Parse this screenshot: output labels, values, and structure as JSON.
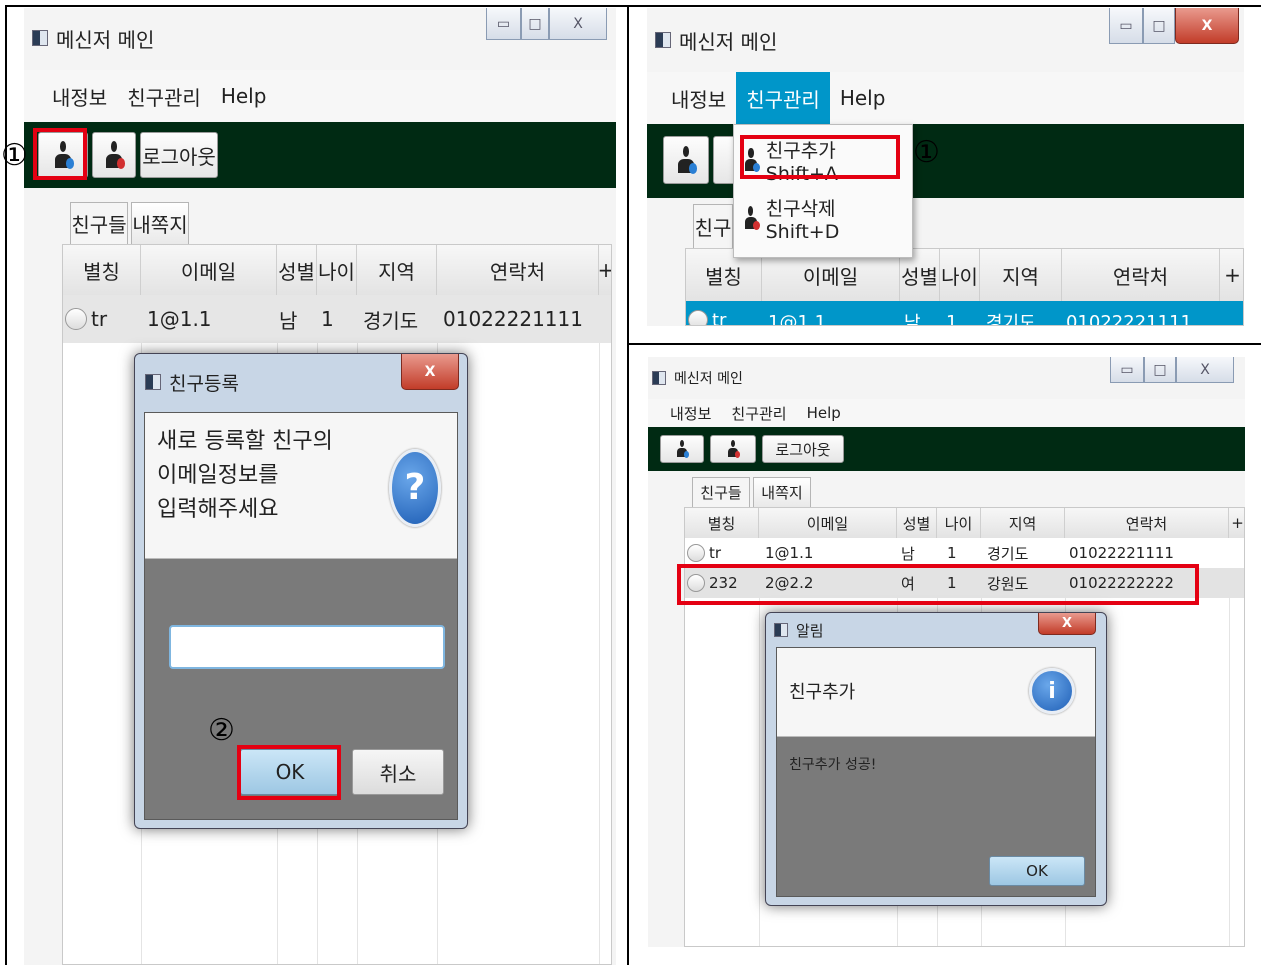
{
  "step_markers": {
    "one": "①",
    "two": "②"
  },
  "window": {
    "title": "메신저 메인",
    "min_glyph": "▭",
    "max_glyph": "□",
    "close_glyph": "X"
  },
  "menu": {
    "my_info": "내정보",
    "friends": "친구관리",
    "help": "Help"
  },
  "toolbar": {
    "logout": "로그아웃"
  },
  "tabs": {
    "friends": "친구들",
    "notes": "내쪽지"
  },
  "table": {
    "headers": [
      "별칭",
      "이메일",
      "성별",
      "나이",
      "지역",
      "연락처"
    ],
    "add_column": "+",
    "rows": [
      {
        "nick": "tr",
        "email": "1@1.1",
        "gender": "남",
        "age": "1",
        "region": "경기도",
        "phone": "01022221111"
      },
      {
        "nick": "232",
        "email": "2@2.2",
        "gender": "여",
        "age": "1",
        "region": "강원도",
        "phone": "01022222222"
      }
    ]
  },
  "dropdown": {
    "add": "친구추가 Shift+A",
    "delete": "친구삭제 Shift+D",
    "partial_tab": "친구"
  },
  "register_dialog": {
    "title": "친구등록",
    "message_l1": "새로 등록할 친구의",
    "message_l2": "이메일정보를",
    "message_l3": "입력해주세요",
    "icon": "?",
    "input_value": "",
    "ok": "OK",
    "cancel": "취소",
    "close": "X"
  },
  "alert_dialog": {
    "title": "알림",
    "header": "친구추가",
    "icon": "i",
    "body": "친구추가 성공!",
    "ok": "OK",
    "close": "X"
  },
  "colors": {
    "toolbar_bg": "#002a13",
    "highlight_red": "#e40012",
    "selection_blue": "#0096c9"
  }
}
